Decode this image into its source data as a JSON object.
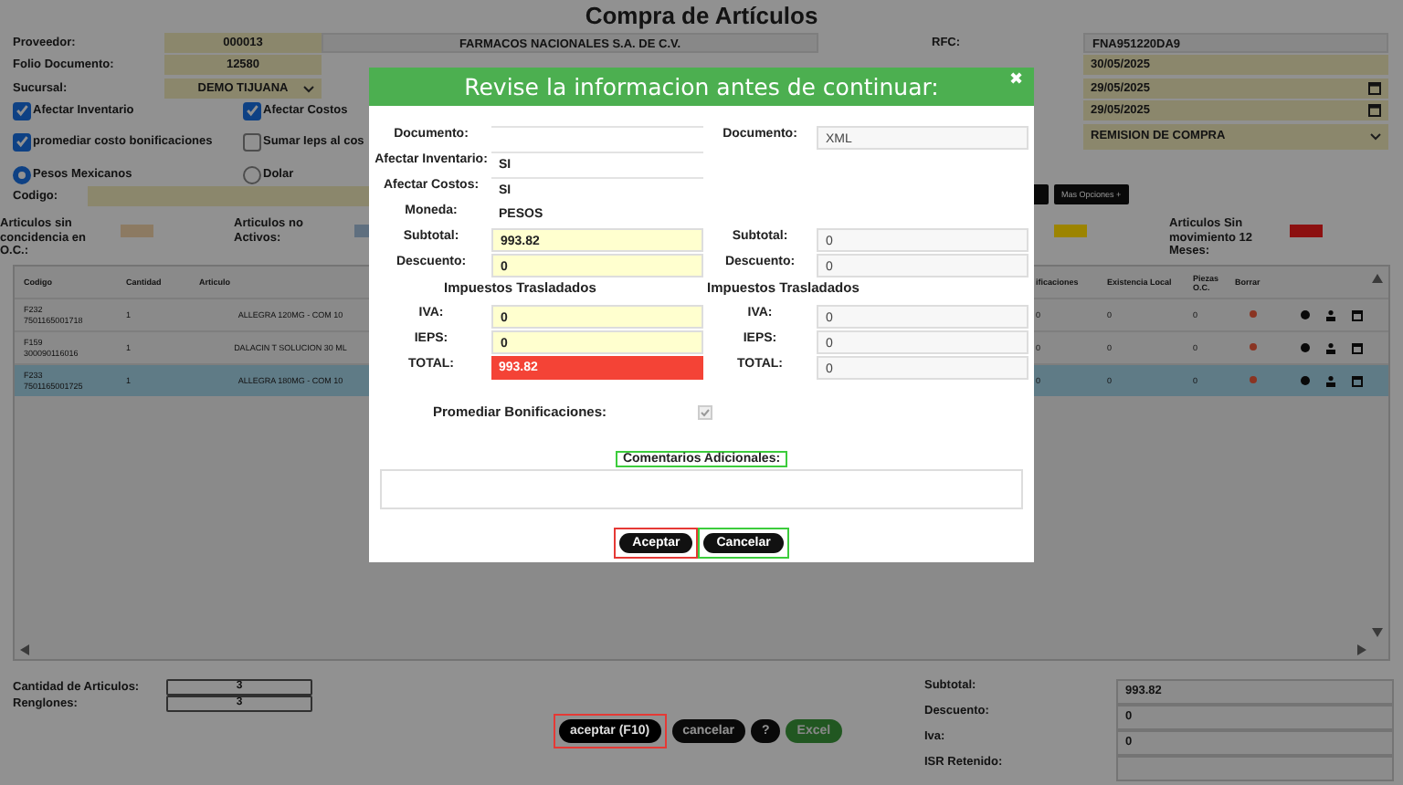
{
  "title": "Compra de Artículos",
  "supplier": {
    "label": "Proveedor:",
    "code": "000013",
    "name": "FARMACOS NACIONALES S.A. DE C.V."
  },
  "folio": {
    "label": "Folio Documento:",
    "value": "12580"
  },
  "branch": {
    "label": "Sucursal:",
    "value": "DEMO TIJUANA"
  },
  "options": [
    {
      "label": "Afectar Inventario",
      "checked": true
    },
    {
      "label": "Afectar Costos",
      "checked": true
    },
    {
      "label": "promediar costo bonificaciones",
      "checked": true
    },
    {
      "label": "Sumar Ieps al cos",
      "checked": false
    }
  ],
  "currency": [
    {
      "label": "Pesos Mexicanos",
      "selected": true
    },
    {
      "label": "Dolar",
      "selected": false
    }
  ],
  "code_label": "Codigo:",
  "rfc": {
    "label": "RFC:",
    "value": "FNA951220DA9"
  },
  "fecha": {
    "value": "30/05/2025"
  },
  "dates": [
    "29/05/2025",
    "29/05/2025"
  ],
  "document_type": "REMISION DE COMPRA",
  "more_button": "Mas Opciones +",
  "legend": [
    {
      "label": "Articulos sin concidencia en O.C.:",
      "color": "#8c7a62"
    },
    {
      "label": "Articulos no Activos:",
      "color": "#5f6f7f"
    },
    {
      "color": "#9c8400"
    },
    {
      "label": "Articulos Sin movimiento 12 Meses:",
      "color": "#8c1010"
    }
  ],
  "table": {
    "columns": [
      "Codigo",
      "Cantidad",
      "Articulo",
      "ificaciones",
      "Existencia Local",
      "Piezas O.C.",
      "Borrar"
    ],
    "rows": [
      {
        "code": "F232",
        "barcode": "7501165001718",
        "qty": "1",
        "article": "ALLEGRA 120MG - COM 10",
        "values": [
          "0",
          "0",
          "0"
        ],
        "selected": false
      },
      {
        "code": "F159",
        "barcode": "300090116016",
        "qty": "1",
        "article": "DALACIN T SOLUCION 30 ML",
        "values": [
          "0",
          "0",
          "0"
        ],
        "selected": false
      },
      {
        "code": "F233",
        "barcode": "7501165001725",
        "qty": "1",
        "article": "ALLEGRA 180MG - COM 10",
        "values": [
          "0",
          "0",
          "0"
        ],
        "selected": true
      }
    ]
  },
  "summary": {
    "count_label": "Cantidad de Articulos:",
    "count": "3",
    "rows_label": "Renglones:",
    "rows": "3"
  },
  "actions": [
    {
      "label": "aceptar (F10)",
      "kind": "primary",
      "color": "#e53935"
    },
    {
      "label": "cancelar",
      "kind": "primary"
    },
    {
      "label": "?",
      "kind": "primary"
    },
    {
      "label": "Excel",
      "kind": "excel"
    }
  ],
  "totals": [
    {
      "label": "Subtotal:",
      "value": "993.82"
    },
    {
      "label": "Descuento:",
      "value": "0"
    },
    {
      "label": "Iva:",
      "value": "0"
    },
    {
      "label": "ISR Retenido:"
    }
  ],
  "modal": {
    "title": "Revise la informacion antes de continuar:",
    "close": "✖",
    "rows": [
      {
        "kind": "field",
        "left": {
          "label": "Documento:",
          "kind": "plain"
        },
        "right": {
          "label": "Documento:",
          "value": "XML",
          "kind": "gray"
        }
      },
      {
        "kind": "field",
        "left": {
          "label": "Afectar Inventario:",
          "value": "SI",
          "kind": "plain"
        }
      },
      {
        "kind": "field",
        "left": {
          "label": "Afectar Costos:",
          "value": "SI",
          "kind": "plain"
        }
      },
      {
        "kind": "field",
        "left": {
          "label": "Moneda:",
          "value": "PESOS",
          "kind": "bare"
        }
      },
      {
        "kind": "field",
        "left": {
          "label": "Subtotal:",
          "value": "993.82",
          "kind": "yellow"
        },
        "right": {
          "label": "Subtotal:",
          "value": "0",
          "kind": "gray"
        }
      },
      {
        "kind": "field",
        "left": {
          "label": "Descuento:",
          "value": "0",
          "kind": "yellow"
        },
        "right": {
          "label": "Descuento:",
          "value": "0",
          "kind": "gray"
        }
      },
      {
        "kind": "heading",
        "left": "Impuestos Trasladados",
        "right": "Impuestos Trasladados"
      },
      {
        "kind": "field",
        "left": {
          "label": "IVA:",
          "value": "0",
          "kind": "yellow"
        },
        "right": {
          "label": "IVA:",
          "value": "0",
          "kind": "gray"
        }
      },
      {
        "kind": "field",
        "left": {
          "label": "IEPS:",
          "value": "0",
          "kind": "yellow"
        },
        "right": {
          "label": "IEPS:",
          "value": "0",
          "kind": "gray"
        }
      },
      {
        "kind": "field",
        "left": {
          "label": "TOTAL:",
          "value": "993.82",
          "kind": "alert"
        },
        "right": {
          "label": "TOTAL:",
          "value": "0",
          "kind": "gray"
        }
      }
    ],
    "average": {
      "label": "Promediar Bonificaciones:",
      "checked": true
    },
    "comments": {
      "label": "Comentarios Adicionales:",
      "color": "#3ccc3c"
    },
    "buttons": [
      {
        "label": "Aceptar",
        "color": "#e53935"
      },
      {
        "label": "Cancelar",
        "color": "#3ccc3c"
      }
    ]
  }
}
